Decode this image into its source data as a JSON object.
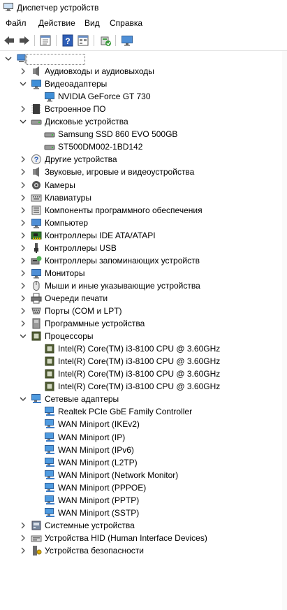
{
  "window": {
    "title": "Диспетчер устройств"
  },
  "menu": [
    "Файл",
    "Действие",
    "Вид",
    "Справка"
  ],
  "toolbar": {
    "buttons": [
      "back-icon",
      "forward-icon",
      "properties-icon",
      "help-icon",
      "show-hidden-icon",
      "update-driver-icon",
      "monitor-icon"
    ]
  },
  "tree": [
    {
      "depth": 0,
      "state": "expanded",
      "icon": "computer-icon",
      "label": ""
    },
    {
      "depth": 1,
      "state": "collapsed",
      "icon": "speaker-icon",
      "label": "Аудиовходы и аудиовыходы"
    },
    {
      "depth": 1,
      "state": "expanded",
      "icon": "display-adapter-icon",
      "label": "Видеоадаптеры"
    },
    {
      "depth": 2,
      "state": "leaf",
      "icon": "display-adapter-icon",
      "label": "NVIDIA GeForce GT 730"
    },
    {
      "depth": 1,
      "state": "collapsed",
      "icon": "firmware-icon",
      "label": "Встроенное ПО"
    },
    {
      "depth": 1,
      "state": "expanded",
      "icon": "disk-icon",
      "label": "Дисковые устройства"
    },
    {
      "depth": 2,
      "state": "leaf",
      "icon": "disk-icon",
      "label": "Samsung SSD 860 EVO 500GB"
    },
    {
      "depth": 2,
      "state": "leaf",
      "icon": "disk-icon",
      "label": "ST500DM002-1BD142"
    },
    {
      "depth": 1,
      "state": "collapsed",
      "icon": "unknown-device-icon",
      "label": "Другие устройства"
    },
    {
      "depth": 1,
      "state": "collapsed",
      "icon": "speaker-icon",
      "label": "Звуковые, игровые и видеоустройства"
    },
    {
      "depth": 1,
      "state": "collapsed",
      "icon": "camera-icon",
      "label": "Камеры"
    },
    {
      "depth": 1,
      "state": "collapsed",
      "icon": "keyboard-icon",
      "label": "Клавиатуры"
    },
    {
      "depth": 1,
      "state": "collapsed",
      "icon": "software-component-icon",
      "label": "Компоненты программного обеспечения"
    },
    {
      "depth": 1,
      "state": "collapsed",
      "icon": "monitor-icon",
      "label": "Компьютер"
    },
    {
      "depth": 1,
      "state": "collapsed",
      "icon": "ide-controller-icon",
      "label": "Контроллеры IDE ATA/ATAPI"
    },
    {
      "depth": 1,
      "state": "collapsed",
      "icon": "usb-icon",
      "label": "Контроллеры USB"
    },
    {
      "depth": 1,
      "state": "collapsed",
      "icon": "storage-controller-icon",
      "label": "Контроллеры запоминающих устройств"
    },
    {
      "depth": 1,
      "state": "collapsed",
      "icon": "monitor-icon",
      "label": "Мониторы"
    },
    {
      "depth": 1,
      "state": "collapsed",
      "icon": "mouse-icon",
      "label": "Мыши и иные указывающие устройства"
    },
    {
      "depth": 1,
      "state": "collapsed",
      "icon": "printer-icon",
      "label": "Очереди печати"
    },
    {
      "depth": 1,
      "state": "collapsed",
      "icon": "port-icon",
      "label": "Порты (COM и LPT)"
    },
    {
      "depth": 1,
      "state": "collapsed",
      "icon": "software-device-icon",
      "label": "Программные устройства"
    },
    {
      "depth": 1,
      "state": "expanded",
      "icon": "processor-icon",
      "label": "Процессоры"
    },
    {
      "depth": 2,
      "state": "leaf",
      "icon": "processor-icon",
      "label": "Intel(R) Core(TM) i3-8100 CPU @ 3.60GHz"
    },
    {
      "depth": 2,
      "state": "leaf",
      "icon": "processor-icon",
      "label": "Intel(R) Core(TM) i3-8100 CPU @ 3.60GHz"
    },
    {
      "depth": 2,
      "state": "leaf",
      "icon": "processor-icon",
      "label": "Intel(R) Core(TM) i3-8100 CPU @ 3.60GHz"
    },
    {
      "depth": 2,
      "state": "leaf",
      "icon": "processor-icon",
      "label": "Intel(R) Core(TM) i3-8100 CPU @ 3.60GHz"
    },
    {
      "depth": 1,
      "state": "expanded",
      "icon": "network-adapter-icon",
      "label": "Сетевые адаптеры"
    },
    {
      "depth": 2,
      "state": "leaf",
      "icon": "network-adapter-icon",
      "label": "Realtek PCIe GbE Family Controller"
    },
    {
      "depth": 2,
      "state": "leaf",
      "icon": "network-adapter-icon",
      "label": "WAN Miniport (IKEv2)"
    },
    {
      "depth": 2,
      "state": "leaf",
      "icon": "network-adapter-icon",
      "label": "WAN Miniport (IP)"
    },
    {
      "depth": 2,
      "state": "leaf",
      "icon": "network-adapter-icon",
      "label": "WAN Miniport (IPv6)"
    },
    {
      "depth": 2,
      "state": "leaf",
      "icon": "network-adapter-icon",
      "label": "WAN Miniport (L2TP)"
    },
    {
      "depth": 2,
      "state": "leaf",
      "icon": "network-adapter-icon",
      "label": "WAN Miniport (Network Monitor)"
    },
    {
      "depth": 2,
      "state": "leaf",
      "icon": "network-adapter-icon",
      "label": "WAN Miniport (PPPOE)"
    },
    {
      "depth": 2,
      "state": "leaf",
      "icon": "network-adapter-icon",
      "label": "WAN Miniport (PPTP)"
    },
    {
      "depth": 2,
      "state": "leaf",
      "icon": "network-adapter-icon",
      "label": "WAN Miniport (SSTP)"
    },
    {
      "depth": 1,
      "state": "collapsed",
      "icon": "system-device-icon",
      "label": "Системные устройства"
    },
    {
      "depth": 1,
      "state": "collapsed",
      "icon": "hid-icon",
      "label": "Устройства HID (Human Interface Devices)"
    },
    {
      "depth": 1,
      "state": "collapsed",
      "icon": "security-device-icon",
      "label": "Устройства безопасности"
    }
  ]
}
